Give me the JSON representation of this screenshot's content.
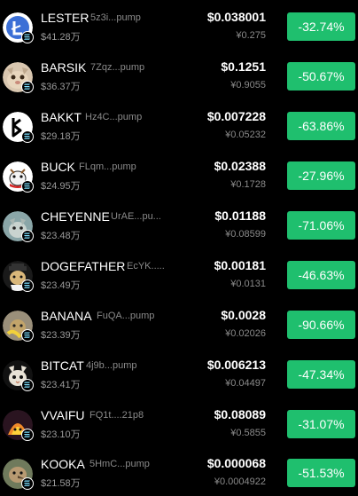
{
  "colors": {
    "background": "#000000",
    "change_badge": "#1fbf6e",
    "muted_text": "#8a8a8a"
  },
  "tokens": [
    {
      "name": "LESTER",
      "address": "5z3i...pump",
      "market_cap": "$41.28万",
      "price_usd": "$0.038001",
      "price_cny": "¥0.275",
      "change": "-32.74%",
      "icon": "lester-avatar-icon"
    },
    {
      "name": "BARSIK",
      "address": "7Zqz...pump",
      "market_cap": "$36.37万",
      "price_usd": "$0.1251",
      "price_cny": "¥0.9055",
      "change": "-50.67%",
      "icon": "barsik-avatar-icon"
    },
    {
      "name": "BAKKT",
      "address": "Hz4C...pump",
      "market_cap": "$29.18万",
      "price_usd": "$0.007228",
      "price_cny": "¥0.05232",
      "change": "-63.86%",
      "icon": "bakkt-avatar-icon"
    },
    {
      "name": "BUCK",
      "address": "FLqm...pump",
      "market_cap": "$24.95万",
      "price_usd": "$0.02388",
      "price_cny": "¥0.1728",
      "change": "-27.96%",
      "icon": "buck-avatar-icon"
    },
    {
      "name": "CHEYENNE",
      "address": "UrAE...pu...",
      "market_cap": "$23.48万",
      "price_usd": "$0.01188",
      "price_cny": "¥0.08599",
      "change": "-71.06%",
      "icon": "cheyenne-avatar-icon"
    },
    {
      "name": "DOGEFATHER",
      "address": "EcYK.....",
      "market_cap": "$23.49万",
      "price_usd": "$0.00181",
      "price_cny": "¥0.0131",
      "change": "-46.63%",
      "icon": "dogefather-avatar-icon"
    },
    {
      "name": "BANANA",
      "address": "FuQA...pump",
      "market_cap": "$23.39万",
      "price_usd": "$0.0028",
      "price_cny": "¥0.02026",
      "change": "-90.66%",
      "icon": "banana-avatar-icon"
    },
    {
      "name": "BITCAT",
      "address": "4j9b...pump",
      "market_cap": "$23.41万",
      "price_usd": "$0.006213",
      "price_cny": "¥0.04497",
      "change": "-47.34%",
      "icon": "bitcat-avatar-icon"
    },
    {
      "name": "VVAIFU",
      "address": "FQ1t....21p8",
      "market_cap": "$23.10万",
      "price_usd": "$0.08089",
      "price_cny": "¥0.5855",
      "change": "-31.07%",
      "icon": "vvaifu-avatar-icon"
    },
    {
      "name": "KOOKA",
      "address": "5HmC...pump",
      "market_cap": "$21.58万",
      "price_usd": "$0.000068",
      "price_cny": "¥0.0004922",
      "change": "-51.53%",
      "icon": "kooka-avatar-icon"
    }
  ]
}
